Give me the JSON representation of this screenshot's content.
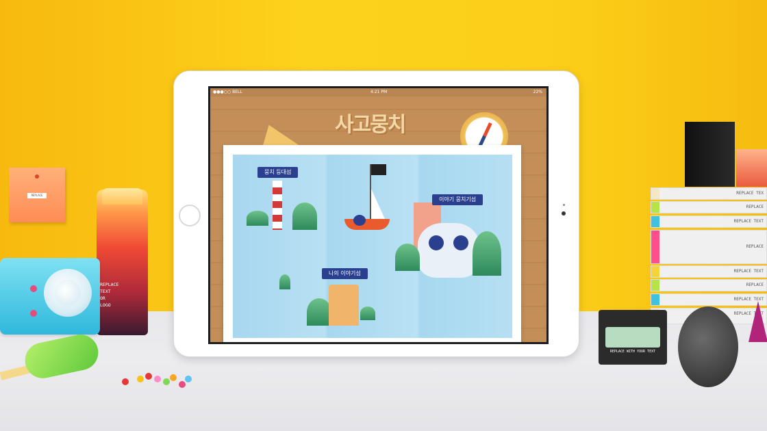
{
  "scene": {
    "sticky_note_label": "REPLACE",
    "bottle_text": "REPLACE\nTEXT\nOR\nLOGO",
    "cassette_label": "REPLACE WITH YOUR TEXT"
  },
  "ipad": {
    "status_bar": {
      "carrier": "●●●○○ BELL",
      "time": "4:21 PM",
      "battery": "22%"
    },
    "app": {
      "title": "사고뭉치",
      "map_labels": [
        {
          "text": "뭉치 등대섬"
        },
        {
          "text": "이야기 뭉치기섬"
        },
        {
          "text": "나의 이야기섬"
        }
      ]
    }
  },
  "books": [
    {
      "label": "REPLACE TEX",
      "color": "#f3e7c6"
    },
    {
      "label": "REPLACE",
      "color": "#b6e24a"
    },
    {
      "label": "REPLACE TEXT",
      "color": "#3fc1e0"
    },
    {
      "label": "REPLACE",
      "color": "#ff4f8b"
    },
    {
      "label": "REPLACE TEXT",
      "color": "#f5d43a"
    },
    {
      "label": "REPLACE",
      "color": "#b6e24a"
    },
    {
      "label": "REPLACE TEXT",
      "color": "#3fc1e0"
    },
    {
      "label": "REPLACE TEXT",
      "color": "#f3e7c6"
    }
  ]
}
